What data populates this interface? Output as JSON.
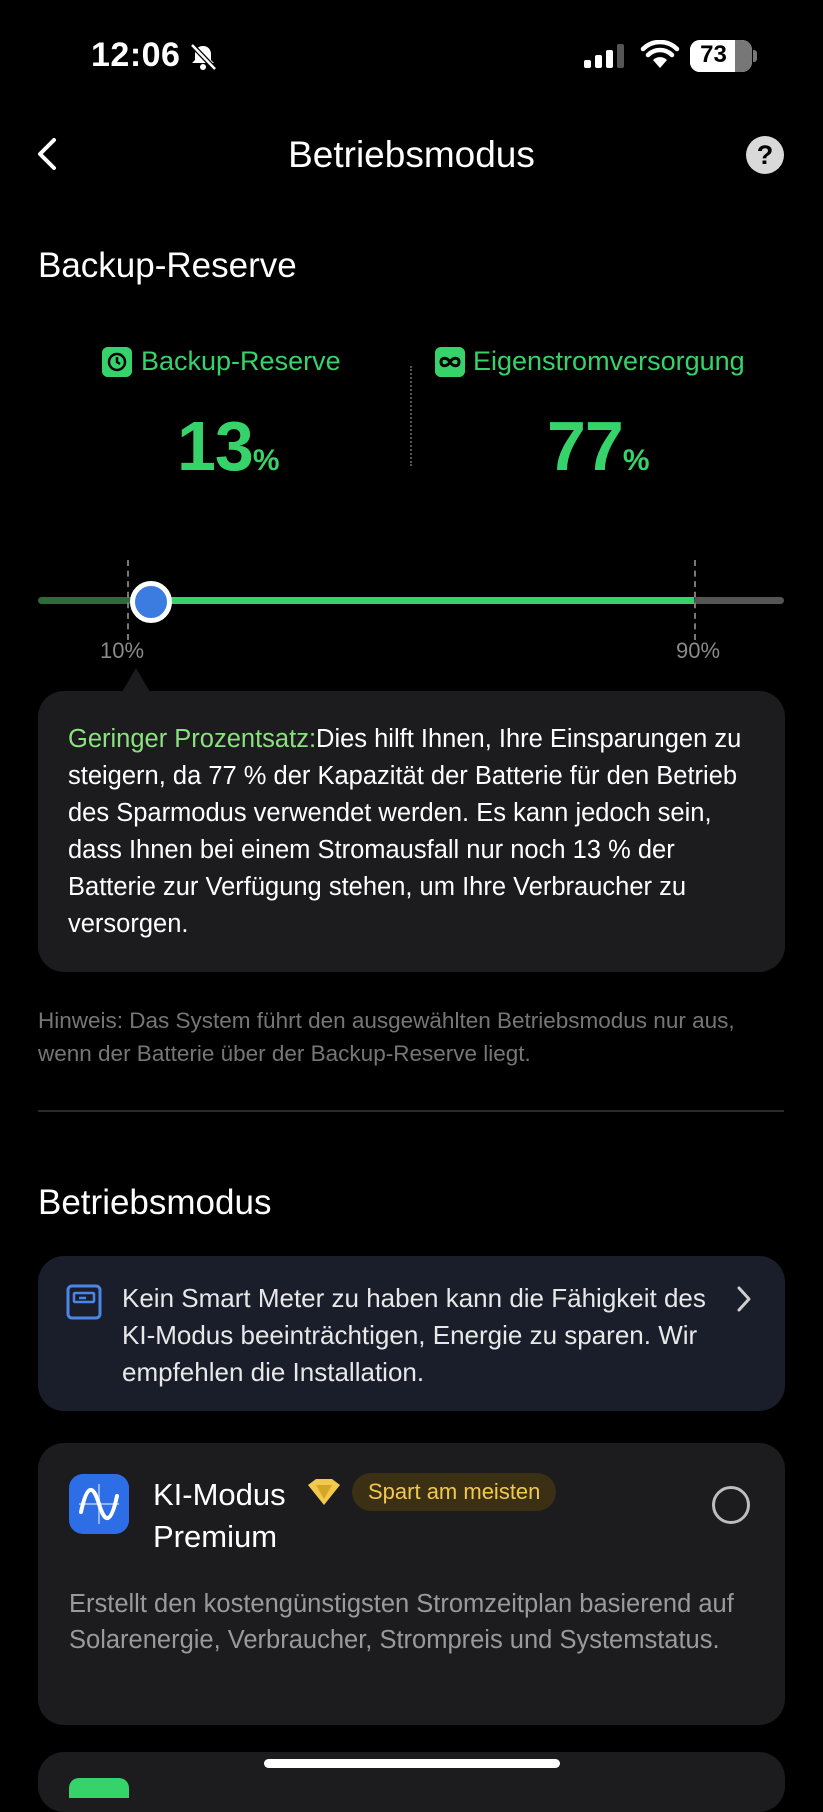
{
  "status_bar": {
    "time": "12:06",
    "battery": "73"
  },
  "header": {
    "title": "Betriebsmodus",
    "help_label": "?"
  },
  "backup": {
    "section_title": "Backup-Reserve",
    "reserve_label": "Backup-Reserve",
    "reserve_value": "13",
    "self_label": "Eigenstromversorgung",
    "self_value": "77",
    "unit": "%",
    "slider_value_percent": 13,
    "slider_min_label": "10%",
    "slider_max_label": "90%"
  },
  "info": {
    "highlight": "Geringer Prozentsatz:",
    "text": "Dies hilft Ihnen, Ihre Einsparungen zu steigern, da 77 % der Kapazität der Batterie für den Betrieb des Sparmodus verwendet werden. Es kann jedoch sein, dass Ihnen bei einem Stromausfall nur noch 13 % der Batterie zur Verfügung stehen, um Ihre Verbraucher zu versorgen."
  },
  "hint": "Hinweis: Das System führt den ausgewählten Betriebsmodus nur aus, wenn der Batterie über der Backup-Reserve liegt.",
  "mode": {
    "section_title": "Betriebsmodus",
    "banner_text": "Kein Smart Meter zu haben kann die Fähigkeit des KI-Modus beeinträchtigen, Energie zu sparen. Wir empfehlen die Installation.",
    "card": {
      "title_line1": "KI-Modus",
      "title_line2": "Premium",
      "badge": "Spart am meisten",
      "description": "Erstellt den kostengünstigsten Stromzeitplan basierend auf Solarenergie, Verbraucher, Strompreis und Systemstatus."
    }
  },
  "icons": {
    "back": "chevron-left-icon",
    "help": "help-icon",
    "silent": "bell-slash-icon",
    "reserve": "backup-icon",
    "self": "infinity-icon",
    "banner": "smart-meter-icon",
    "mode": "ai-wave-icon",
    "premium": "diamond-icon"
  },
  "colors": {
    "accent_green": "#35d36a",
    "thumb_blue": "#3c7be0",
    "badge_text": "#f2c94c",
    "card_bg": "#1c1c1e"
  }
}
